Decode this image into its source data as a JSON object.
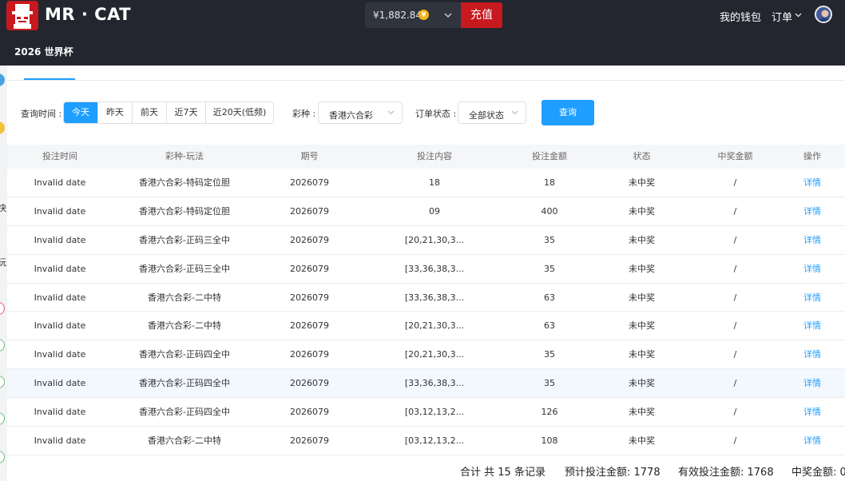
{
  "header": {
    "brand": "MR · CAT",
    "balance": "¥1,882.84",
    "coin_symbol": "¥",
    "recharge_label": "充值",
    "wallet_label": "我的钱包",
    "orders_label": "订单",
    "subnav_title": "2026 世界杯",
    "colors": {
      "bar": "#23262f",
      "brand_red": "#c8191e",
      "accent_blue": "#1e9fff"
    }
  },
  "filters": {
    "time_label": "查询时间 :",
    "day_options": [
      "今天",
      "昨天",
      "前天",
      "近7天",
      "近20天(低频)"
    ],
    "active_day": "今天",
    "lottery_label": "彩种 :",
    "lottery_value": "香港六合彩",
    "status_label": "订单状态 :",
    "status_value": "全部状态",
    "query_label": "查询"
  },
  "table": {
    "columns": [
      "投注时间",
      "彩种-玩法",
      "期号",
      "投注内容",
      "投注金额",
      "状态",
      "中奖金额",
      "操作"
    ],
    "rows": [
      [
        "Invalid date",
        "香港六合彩-特码定位胆",
        "2026079",
        "18",
        "18",
        "未中奖",
        "/",
        "详情"
      ],
      [
        "Invalid date",
        "香港六合彩-特码定位胆",
        "2026079",
        "09",
        "400",
        "未中奖",
        "/",
        "详情"
      ],
      [
        "Invalid date",
        "香港六合彩-正码三全中",
        "2026079",
        "[20,21,30,3...",
        "35",
        "未中奖",
        "/",
        "详情"
      ],
      [
        "Invalid date",
        "香港六合彩-正码三全中",
        "2026079",
        "[33,36,38,3...",
        "35",
        "未中奖",
        "/",
        "详情"
      ],
      [
        "Invalid date",
        "香港六合彩-二中特",
        "2026079",
        "[33,36,38,3...",
        "63",
        "未中奖",
        "/",
        "详情"
      ],
      [
        "Invalid date",
        "香港六合彩-二中特",
        "2026079",
        "[20,21,30,3...",
        "63",
        "未中奖",
        "/",
        "详情"
      ],
      [
        "Invalid date",
        "香港六合彩-正码四全中",
        "2026079",
        "[20,21,30,3...",
        "35",
        "未中奖",
        "/",
        "详情"
      ],
      [
        "Invalid date",
        "香港六合彩-正码四全中",
        "2026079",
        "[33,36,38,3...",
        "35",
        "未中奖",
        "/",
        "详情"
      ],
      [
        "Invalid date",
        "香港六合彩-正码四全中",
        "2026079",
        "[03,12,13,2...",
        "126",
        "未中奖",
        "/",
        "详情"
      ],
      [
        "Invalid date",
        "香港六合彩-二中特",
        "2026079",
        "[03,12,13,2...",
        "108",
        "未中奖",
        "/",
        "详情"
      ]
    ],
    "highlighted_row": 7
  },
  "summary": {
    "total_records": "合计 共 15 条记录",
    "expected_bet": "预计投注金额: 1778",
    "valid_bet": "有效投注金额: 1768",
    "win_amount": "中奖金额: 0"
  },
  "left_strip": {
    "chars": [
      "快",
      "玩"
    ]
  }
}
